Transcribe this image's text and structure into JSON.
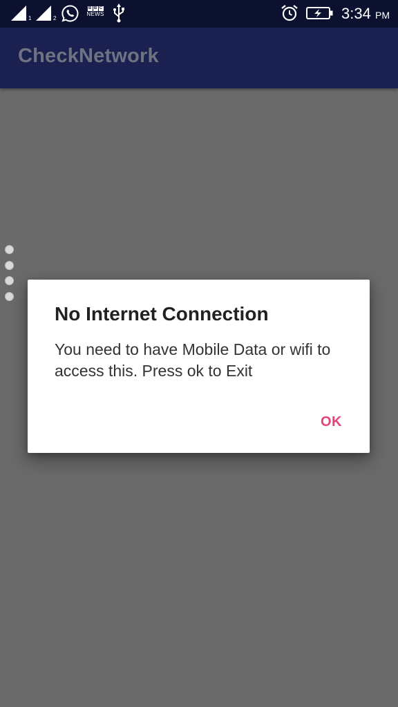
{
  "status_bar": {
    "time": "3:34",
    "ampm": "PM",
    "sim1_label": "1",
    "sim2_label": "2",
    "bbc_letters": [
      "B",
      "B",
      "C"
    ],
    "bbc_news": "NEWS",
    "icons": [
      "signal-sim1-icon",
      "signal-sim2-icon",
      "whatsapp-icon",
      "bbc-news-icon",
      "usb-icon",
      "alarm-icon",
      "battery-charging-icon"
    ]
  },
  "app_bar": {
    "title": "CheckNetwork"
  },
  "dialog": {
    "title": "No Internet Connection",
    "message": "You need to have Mobile Data or wifi to access this. Press ok to Exit",
    "ok_label": "OK"
  },
  "colors": {
    "status_bar_bg": "#0c1130",
    "app_bar_bg": "#1a2150",
    "scrim_bg": "#6a6a6a",
    "accent": "#e8407c"
  }
}
